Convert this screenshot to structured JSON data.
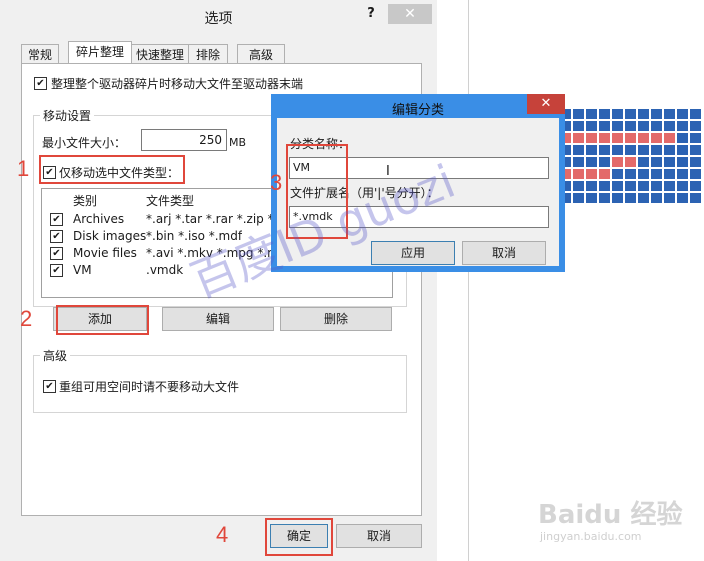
{
  "main_dialog": {
    "title": "选项",
    "help_glyph": "?",
    "close_glyph": "✕",
    "tabs": [
      "常规",
      "碎片整理",
      "快速整理",
      "排除",
      "高级"
    ],
    "active_tab": "碎片整理",
    "move_large_to_end_label": "整理整个驱动器碎片时移动大文件至驱动器末端",
    "move_settings": {
      "group_title": "移动设置",
      "min_size_label": "最小文件大小：",
      "min_size_value": "250",
      "min_size_unit": "MB",
      "only_selected_types_label": "仅移动选中文件类型："
    },
    "list": {
      "col_category": "类别",
      "col_types": "文件类型",
      "rows": [
        {
          "category": "Archives",
          "types": "*.arj *.tar *.rar *.zip *.ca",
          "checked": true
        },
        {
          "category": "Disk images",
          "types": "*.bin *.iso *.mdf",
          "checked": true
        },
        {
          "category": "Movie files",
          "types": "*.avi *.mkv *.mpg *.mov",
          "checked": true
        },
        {
          "category": "VM",
          "types": ".vmdk",
          "checked": true
        }
      ]
    },
    "buttons": {
      "add": "添加",
      "edit": "编辑",
      "delete": "删除"
    },
    "advanced": {
      "group_title": "高级",
      "no_move_label": "重组可用空间时请不要移动大文件"
    },
    "ok": "确定",
    "cancel": "取消"
  },
  "edit_dialog": {
    "title": "编辑分类",
    "close_glyph": "✕",
    "name_label": "分类名称：",
    "name_value": "VM",
    "ext_label": "文件扩展名（用'|'号分开）：",
    "ext_value": "*.vmdk",
    "apply": "应用",
    "cancel": "取消"
  },
  "annotations": [
    "1",
    "2",
    "3",
    "4"
  ],
  "check_glyph": "✔",
  "watermark": "百度ID guozi",
  "baidu_logo": "Baidu 经验",
  "baidu_sub": "jingyan.baidu.com",
  "colors": {
    "accent_red": "#e0473b",
    "dialog_blue": "#3a8ee6",
    "map_red": "#e36a6a",
    "map_blue": "#2c63b3"
  }
}
